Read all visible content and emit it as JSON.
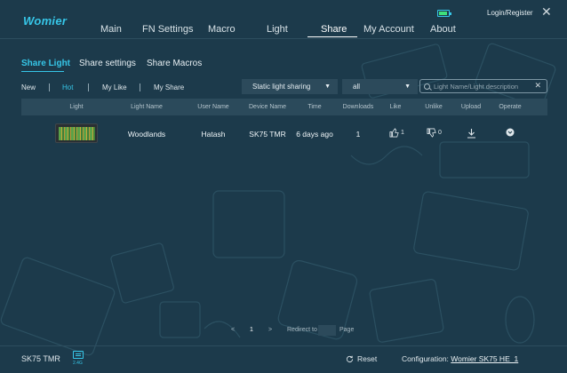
{
  "app": {
    "logo": "Womier",
    "login": "Login/Register"
  },
  "nav": [
    {
      "label": "Main"
    },
    {
      "label": "FN Settings"
    },
    {
      "label": "Macro"
    },
    {
      "label": "Light"
    },
    {
      "label": "Share",
      "active": true
    },
    {
      "label": "My Account"
    },
    {
      "label": "About"
    }
  ],
  "subtabs": [
    {
      "label": "Share Light",
      "active": true
    },
    {
      "label": "Share settings"
    },
    {
      "label": "Share Macros"
    }
  ],
  "filters": [
    {
      "label": "New"
    },
    {
      "label": "Hot",
      "active": true
    },
    {
      "label": "My Like"
    },
    {
      "label": "My Share"
    }
  ],
  "type_dropdown": {
    "value": "Static light sharing"
  },
  "scope_dropdown": {
    "value": "all"
  },
  "search": {
    "placeholder": "Light Name/Light description",
    "value": ""
  },
  "table": {
    "headers": [
      "Light",
      "Light Name",
      "User Name",
      "Device Name",
      "Time",
      "Downloads",
      "Like",
      "Unlike",
      "Upload",
      "Operate"
    ],
    "rows": [
      {
        "light_name": "Woodlands",
        "user_name": "Hatash",
        "device_name": "SK75 TMR",
        "time": "6 days ago",
        "downloads": "1",
        "likes": "1",
        "unlikes": "0"
      }
    ]
  },
  "pager": {
    "prev": "<",
    "page": "1",
    "next": ">",
    "redirect_label": "Redirect to",
    "page_label": "Page"
  },
  "footer": {
    "device": "SK75 TMR",
    "connection": "2.4G",
    "reset": "Reset",
    "config_label": "Configuration:",
    "config_value": "Womier SK75 HE_1"
  },
  "colors": {
    "background": "#1c3a4b",
    "accent": "#36c6e8",
    "header_row": "#2b4a5b"
  }
}
